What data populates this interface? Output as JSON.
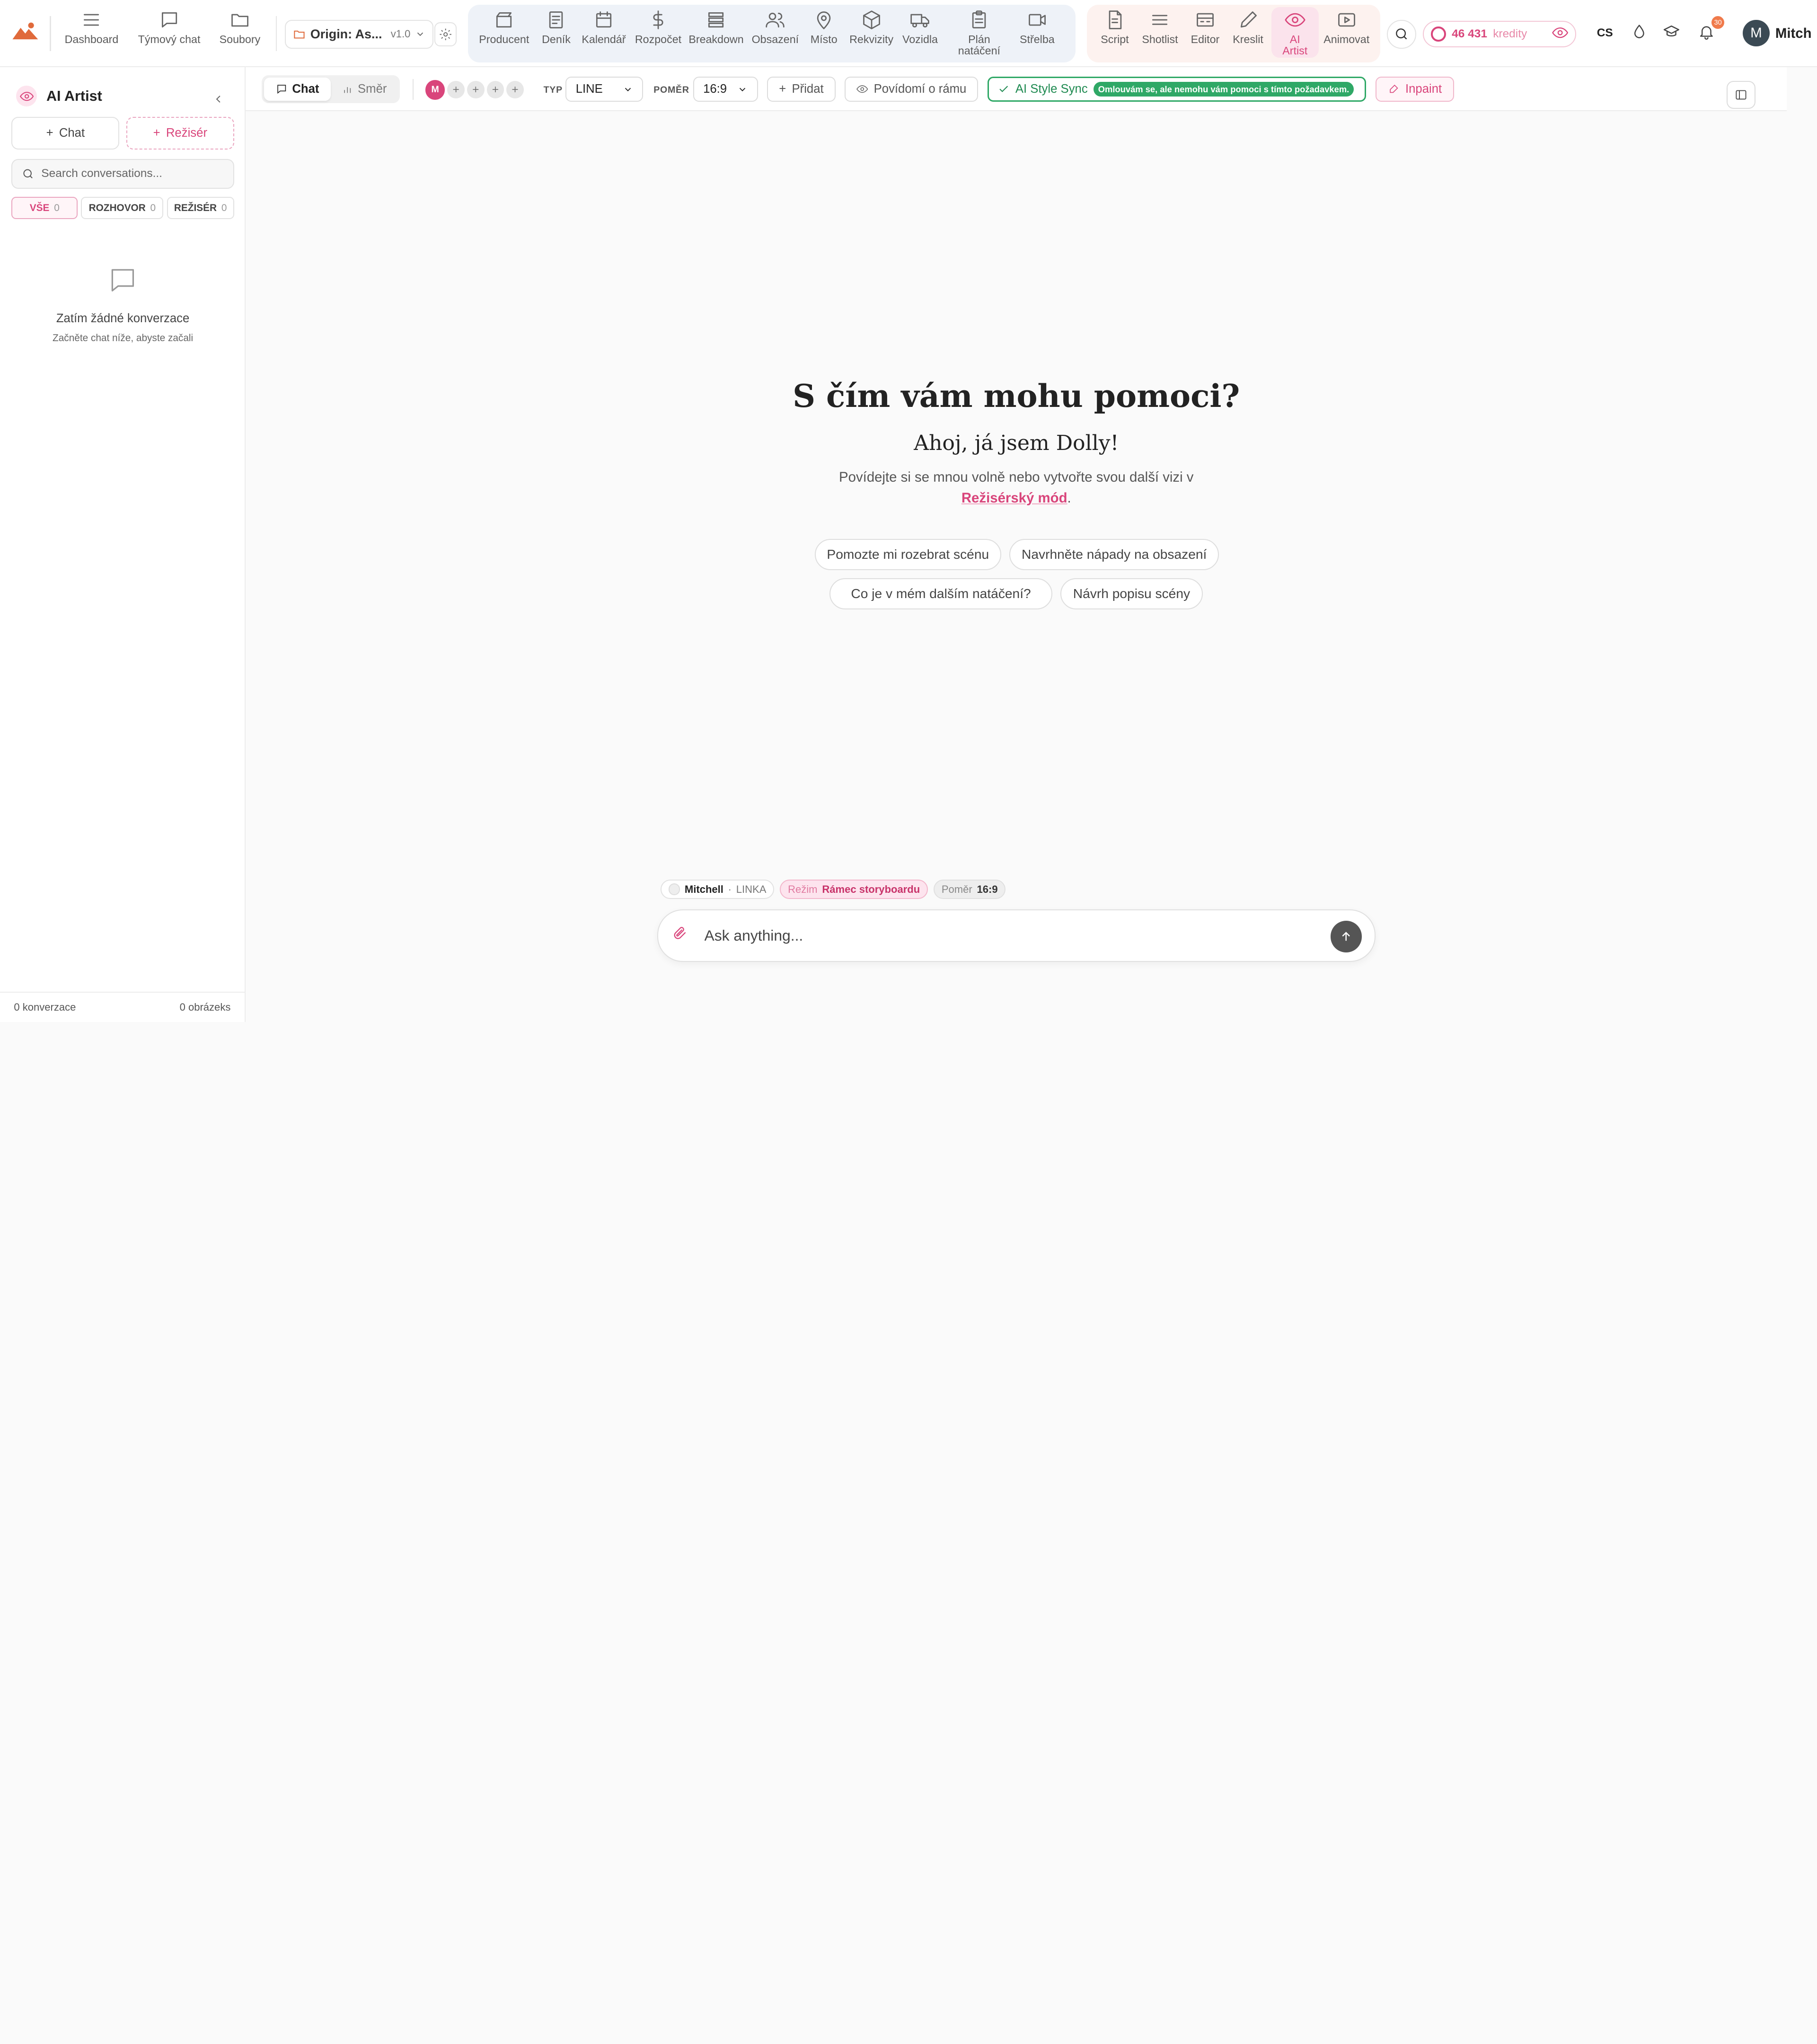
{
  "nav_left": [
    {
      "label": "Dashboard",
      "icon": "menu-icon"
    },
    {
      "label": "Týmový chat",
      "icon": "chat-icon"
    },
    {
      "label": "Soubory",
      "icon": "folder-icon"
    }
  ],
  "project": {
    "name": "Origin: As...",
    "version": "v1.0"
  },
  "production_nav": [
    {
      "label": "Producent",
      "icon": "clapper-icon"
    },
    {
      "label": "Deník",
      "icon": "document-icon"
    },
    {
      "label": "Kalendář",
      "icon": "calendar-icon"
    },
    {
      "label": "Rozpočet",
      "icon": "dollar-icon"
    },
    {
      "label": "Breakdown",
      "icon": "list-icon"
    },
    {
      "label": "Obsazení",
      "icon": "people-icon"
    },
    {
      "label": "Místo",
      "icon": "map-pin-icon"
    },
    {
      "label": "Rekvizity",
      "icon": "box-icon"
    },
    {
      "label": "Vozidla",
      "icon": "truck-icon"
    },
    {
      "label": "Plán natáčení",
      "icon": "clipboard-icon"
    },
    {
      "label": "Střelba",
      "icon": "video-icon"
    }
  ],
  "creative_nav": [
    {
      "label": "Script",
      "icon": "script-icon"
    },
    {
      "label": "Shotlist",
      "icon": "lines-icon"
    },
    {
      "label": "Editor",
      "icon": "editor-icon"
    },
    {
      "label": "Kreslit",
      "icon": "pencil-icon"
    },
    {
      "label": "AI Artist",
      "icon": "eye-icon",
      "active": true
    },
    {
      "label": "Animovat",
      "icon": "play-icon"
    }
  ],
  "credits": {
    "amount": "46 431",
    "unit": "kredity"
  },
  "language": "CS",
  "notifications": {
    "count": "30"
  },
  "user": {
    "initial": "M",
    "name": "Mitch"
  },
  "sidebar": {
    "title": "AI Artist",
    "new_chat": "Chat",
    "new_director": "Režisér",
    "search_placeholder": "Search conversations...",
    "filters": [
      {
        "label": "VŠE",
        "count": "0",
        "active": true
      },
      {
        "label": "ROZHOVOR",
        "count": "0"
      },
      {
        "label": "REŽISÉR",
        "count": "0"
      }
    ],
    "empty_title": "Zatím žádné konverzace",
    "empty_subtitle": "Začněte chat níže, abyste začali",
    "footer_conversations": "0 konverzace",
    "footer_images": "0 obrázeks"
  },
  "toolbar": {
    "mode_chat": "Chat",
    "mode_direction": "Směr",
    "avatar_initial": "M",
    "type_label": "TYP",
    "type_value": "LINE",
    "ratio_label": "POMĚR",
    "ratio_value": "16:9",
    "add_label": "Přidat",
    "frame_talk": "Povídomí o rámu",
    "style_sync": "AI Style Sync",
    "style_sync_badge": "Omlouvám se, ale nemohu vám pomoci s tímto požadavkem.",
    "inpaint": "Inpaint"
  },
  "main": {
    "title": "S čím vám mohu pomoci?",
    "subtitle": "Ahoj, já jsem Dolly!",
    "desc_prefix": "Povídejte si se mnou volně nebo vytvořte svou další vizi v",
    "desc_link": "Režisérský mód",
    "desc_suffix": ".",
    "suggestions": [
      "Pomozte mi rozebrat scénu",
      "Navrhněte nápady na obsazení",
      "Co je v mém dalším natáčení?",
      "Návrh popisu scény"
    ]
  },
  "context": {
    "user": "Mitchell",
    "line": "LINKA",
    "mode_label": "Režim",
    "mode_value": "Rámec storyboardu",
    "ratio_label": "Poměr",
    "ratio_value": "16:9"
  },
  "composer": {
    "placeholder": "Ask anything..."
  },
  "colors": {
    "accent": "#d9457b",
    "success": "#2fa866"
  }
}
